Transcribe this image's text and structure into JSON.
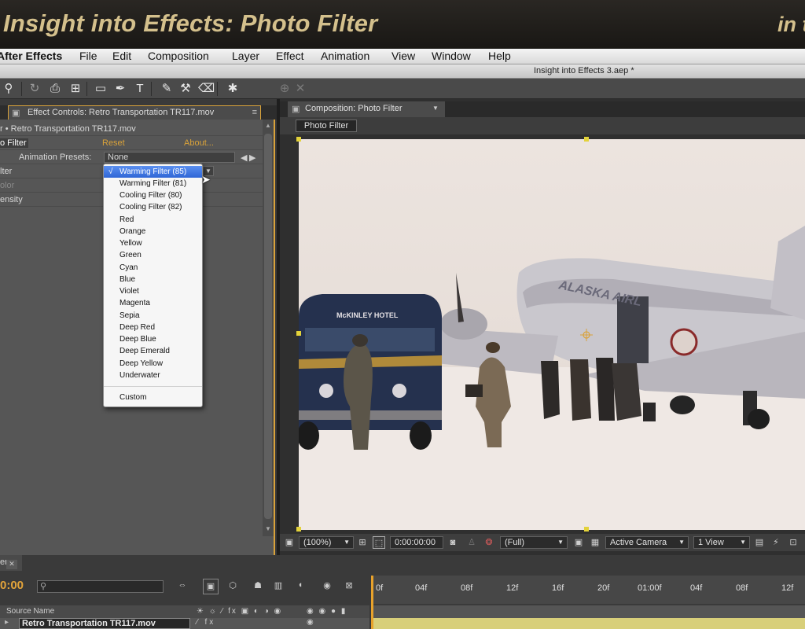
{
  "banner": {
    "title": "Insight into Effects: Photo Filter",
    "right_fragment": "in t"
  },
  "menubar": {
    "app": "After Effects",
    "items": [
      "File",
      "Edit",
      "Composition",
      "Layer",
      "Effect",
      "Animation",
      "View",
      "Window",
      "Help"
    ]
  },
  "document_title": "Insight into Effects 3.aep *",
  "effect_controls": {
    "tab_label": "Effect Controls: Retro Transportation TR117.mov",
    "layer_path": "r • Retro Transportation TR117.mov",
    "effect_name": "o Filter",
    "reset": "Reset",
    "about": "About...",
    "presets_label": "Animation Presets:",
    "presets_value": "None",
    "props": [
      "lter",
      "olor",
      "ensity"
    ]
  },
  "filter_menu": {
    "items": [
      "Warming Filter (85)",
      "Warming Filter (81)",
      "Cooling Filter (80)",
      "Cooling Filter (82)",
      "Red",
      "Orange",
      "Yellow",
      "Green",
      "Cyan",
      "Blue",
      "Violet",
      "Magenta",
      "Sepia",
      "Deep Red",
      "Deep Blue",
      "Deep Emerald",
      "Deep Yellow",
      "Underwater"
    ],
    "custom": "Custom",
    "checkmark": "√",
    "selected_index": 0
  },
  "composition": {
    "tab_label": "Composition: Photo Filter",
    "chip": "Photo Filter",
    "zoom": "(100%)",
    "timecode": "0:00:00:00",
    "resolution": "(Full)",
    "camera": "Active Camera",
    "views": "1 View",
    "bus_sign": "McKINLEY HOTEL",
    "plane_text": "ALASKA AIRL"
  },
  "timeline": {
    "tab_label": "er",
    "time": "0:00",
    "ruler_ticks": [
      "0f",
      "04f",
      "08f",
      "12f",
      "16f",
      "20f",
      "01:00f",
      "04f",
      "08f",
      "12f"
    ],
    "source_name_header": "Source Name",
    "layer_name": "Retro Transportation TR117.mov"
  }
}
